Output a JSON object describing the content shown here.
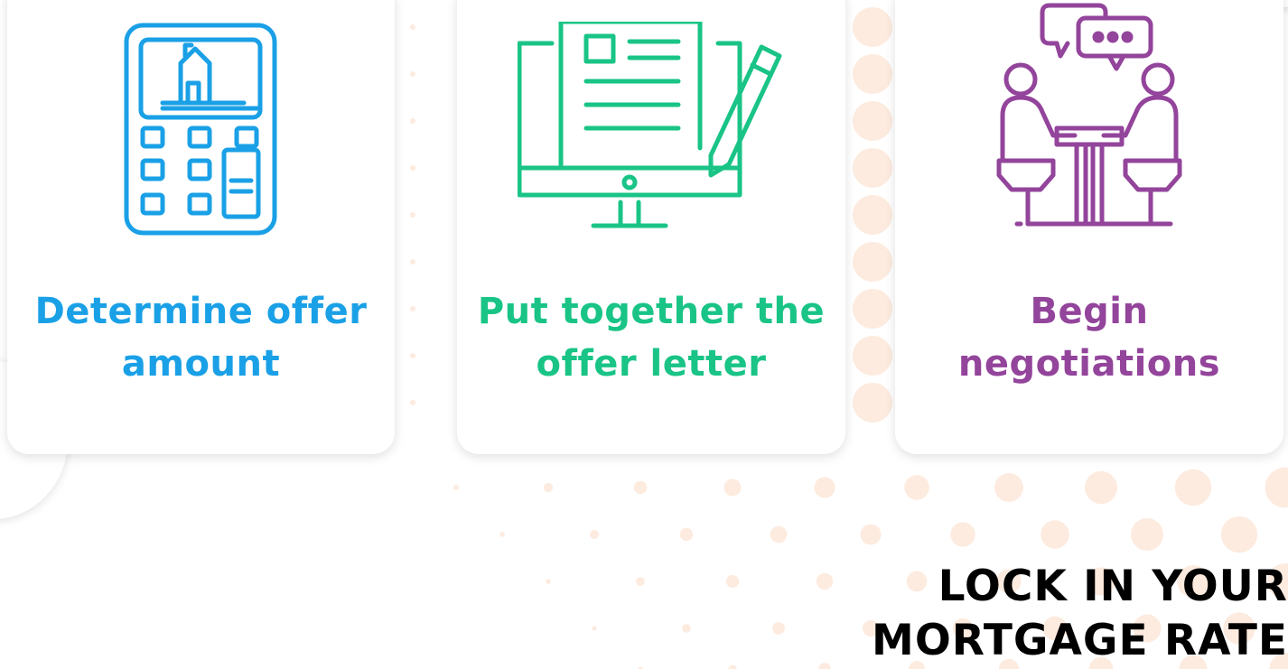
{
  "colors": {
    "blue": "#1aa0e6",
    "green": "#19c486",
    "purple": "#93449b",
    "dot": "#fdebdf",
    "headline": "#000000"
  },
  "steps": [
    {
      "icon": "calculator-house-icon",
      "title_line1": "Determine offer",
      "title_line2": "amount",
      "color": "#1aa0e6"
    },
    {
      "icon": "offer-letter-monitor-icon",
      "title_line1": "Put together the",
      "title_line2": "offer letter",
      "color": "#19c486"
    },
    {
      "icon": "negotiation-meeting-icon",
      "title_line1": "Begin",
      "title_line2": "negotiations",
      "color": "#93449b"
    }
  ],
  "next_step": {
    "line1": "LOCK IN YOUR",
    "line2": "MORTGAGE RATE"
  }
}
